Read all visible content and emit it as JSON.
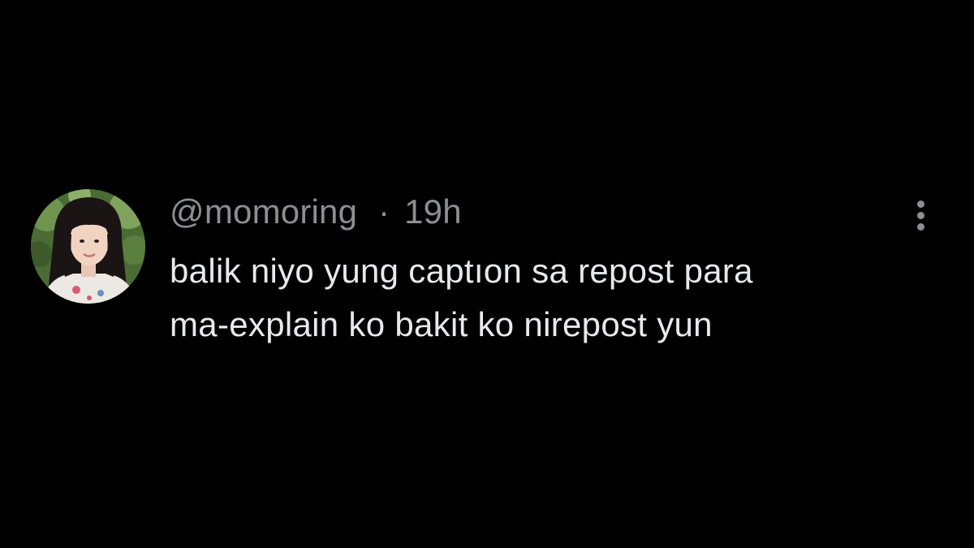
{
  "post": {
    "handle": "@momoring",
    "separator": "·",
    "timestamp": "19h",
    "text_lines": [
      "balik niyo yung captıon sa repost para",
      "ma-explain ko bakit ko nirepost yun"
    ]
  },
  "icons": {
    "more": "more-vertical-icon",
    "avatar": "profile-photo"
  },
  "colors": {
    "background": "#000000",
    "secondary_text": "#8b8f94",
    "primary_text": "#e7e9ea"
  }
}
